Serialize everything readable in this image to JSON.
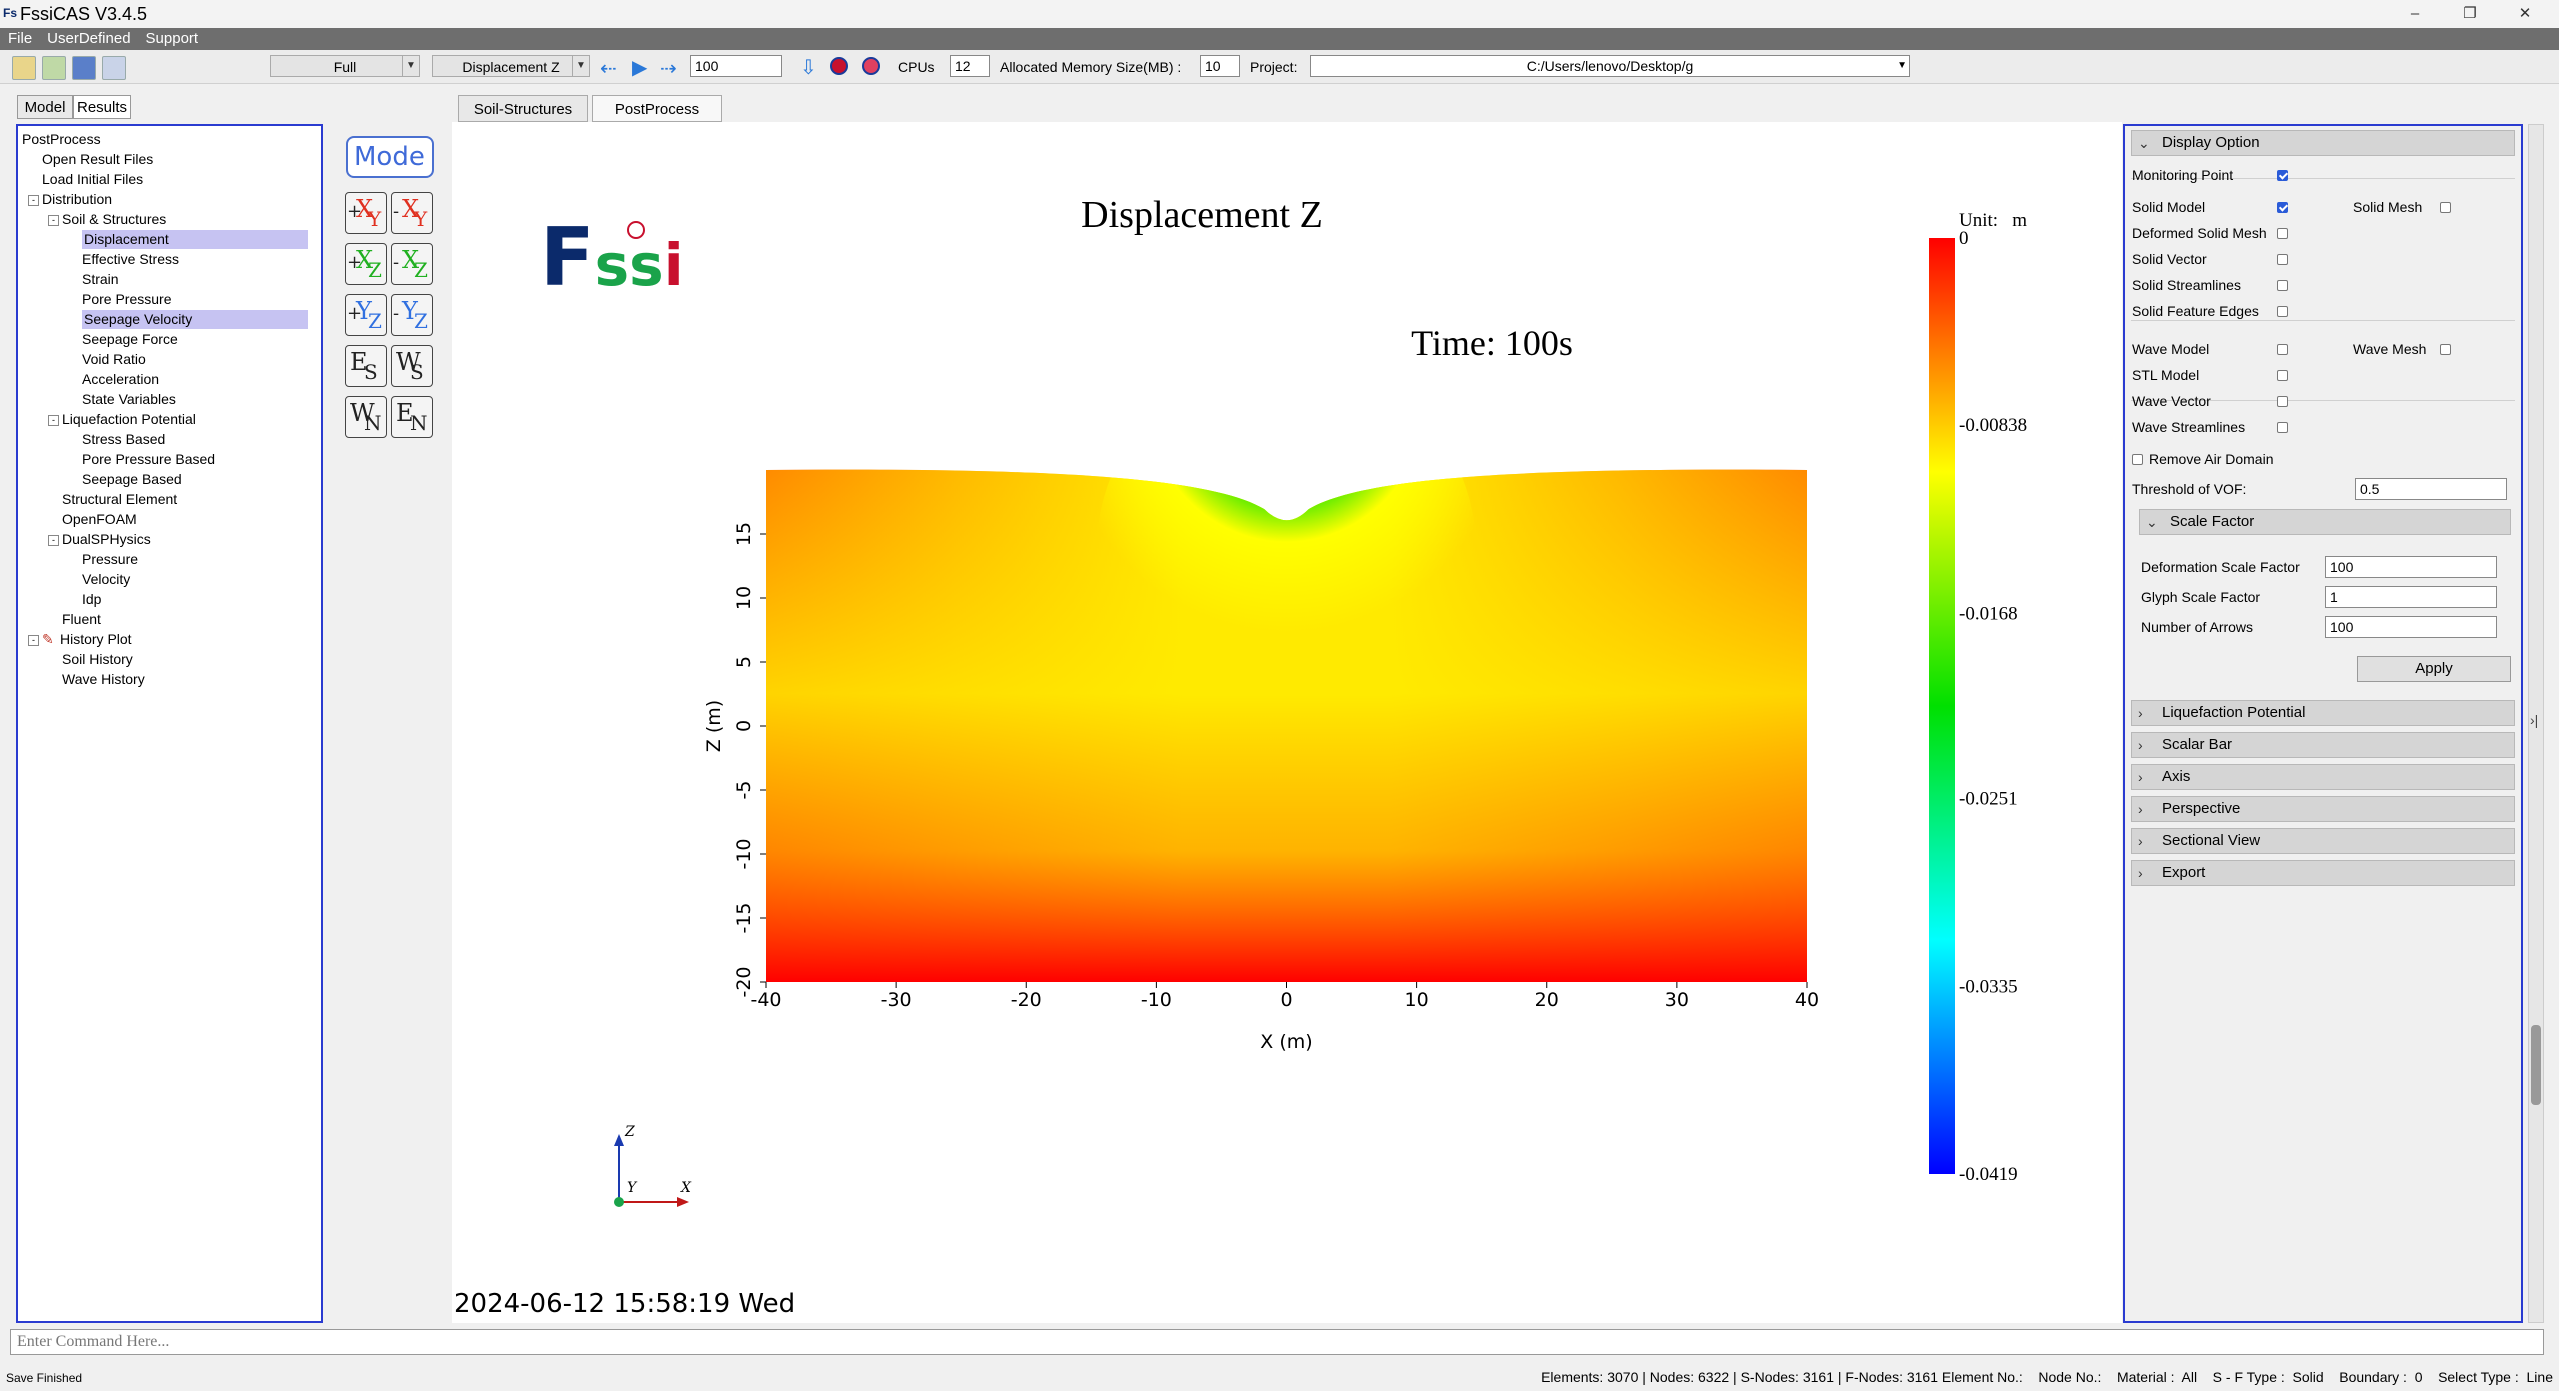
{
  "app": {
    "title": "FssiCAS V3.4.5",
    "logo_text": "Fs"
  },
  "menu": [
    "File",
    "UserDefined",
    "Support"
  ],
  "toolbar": {
    "view_mode": "Full",
    "result_type": "Displacement Z",
    "step_value": "100",
    "cpus_label": "CPUs",
    "cpus_value": "12",
    "memory_label": "Allocated Memory Size(MB) :",
    "memory_value": "10",
    "project_label": "Project:",
    "project_path": "C:/Users/lenovo/Desktop/g"
  },
  "left_tabs": [
    "Model",
    "Results"
  ],
  "tree": [
    {
      "label": "PostProcess",
      "level": 0
    },
    {
      "label": "Open Result Files",
      "level": 1
    },
    {
      "label": "Load Initial Files",
      "level": 1
    },
    {
      "label": "Distribution",
      "level": 1,
      "toggle": "-"
    },
    {
      "label": "Soil & Structures",
      "level": 2,
      "toggle": "-"
    },
    {
      "label": "Displacement",
      "level": 3,
      "selected": true
    },
    {
      "label": "Effective Stress",
      "level": 3
    },
    {
      "label": "Strain",
      "level": 3
    },
    {
      "label": "Pore Pressure",
      "level": 3
    },
    {
      "label": "Seepage Velocity",
      "level": 3,
      "selected": true
    },
    {
      "label": "Seepage Force",
      "level": 3
    },
    {
      "label": "Void Ratio",
      "level": 3
    },
    {
      "label": "Acceleration",
      "level": 3
    },
    {
      "label": "State Variables",
      "level": 3
    },
    {
      "label": "Liquefaction Potential",
      "level": 2,
      "toggle": "-"
    },
    {
      "label": "Stress Based",
      "level": 3
    },
    {
      "label": "Pore Pressure Based",
      "level": 3
    },
    {
      "label": "Seepage Based",
      "level": 3
    },
    {
      "label": "Structural Element",
      "level": 2
    },
    {
      "label": "OpenFOAM",
      "level": 2
    },
    {
      "label": "DualSPHysics",
      "level": 2,
      "toggle": "-"
    },
    {
      "label": "Pressure",
      "level": 3
    },
    {
      "label": "Velocity",
      "level": 3
    },
    {
      "label": "Idp",
      "level": 3
    },
    {
      "label": "Fluent",
      "level": 2
    },
    {
      "label": "History Plot",
      "level": 1,
      "toggle": "-",
      "icon": true
    },
    {
      "label": "Soil History",
      "level": 2
    },
    {
      "label": "Wave History",
      "level": 2
    }
  ],
  "view_buttons": {
    "mode_label": "Mode",
    "rows": [
      [
        {
          "sign": "+",
          "ax": "X",
          "sub": "Y"
        },
        {
          "sign": "-",
          "ax": "X",
          "sub": "Y"
        }
      ],
      [
        {
          "sign": "+",
          "ax": "X",
          "sub": "Z"
        },
        {
          "sign": "-",
          "ax": "X",
          "sub": "Z"
        }
      ],
      [
        {
          "sign": "+",
          "ax": "Y",
          "sub": "Z"
        },
        {
          "sign": "-",
          "ax": "Y",
          "sub": "Z"
        }
      ],
      [
        {
          "sign": "",
          "ax": "E",
          "sub": "S"
        },
        {
          "sign": "",
          "ax": "W",
          "sub": "S"
        }
      ],
      [
        {
          "sign": "",
          "ax": "W",
          "sub": "N"
        },
        {
          "sign": "",
          "ax": "E",
          "sub": "N"
        }
      ]
    ]
  },
  "center_tabs": [
    "Soil-Structures",
    "PostProcess"
  ],
  "plot": {
    "brand": "Fssi",
    "title": "Displacement Z",
    "time_label": "Time: 100s",
    "unit_label": "Unit:   m",
    "colorbar_ticks": [
      "0",
      "-0.00838",
      "-0.0168",
      "-0.0251",
      "-0.0335",
      "-0.0419"
    ],
    "colors": {
      "min": "#0000ff",
      "mid": "#00e000",
      "zero": "#ff0000"
    },
    "timestamp": "2024-06-12 15:58:19 Wed"
  },
  "chart_data": {
    "type": "heatmap",
    "title": "Displacement Z",
    "subtitle": "Time: 100s",
    "xlabel": "X (m)",
    "ylabel": "Z (m)",
    "xlim": [
      -40,
      40
    ],
    "ylim": [
      -20,
      20
    ],
    "x_ticks": [
      -40,
      -30,
      -20,
      -10,
      0,
      10,
      20,
      30,
      40
    ],
    "y_ticks": [
      -20,
      -15,
      -10,
      -5,
      0,
      5,
      10,
      15
    ],
    "colorbar": {
      "min": -0.0419,
      "max": 0,
      "ticks": [
        0,
        -0.00838,
        -0.0168,
        -0.0251,
        -0.0335,
        -0.0419
      ],
      "unit": "m"
    },
    "min_location": [
      0,
      16
    ]
  },
  "right_panel": {
    "header": "Display Option",
    "options": [
      {
        "label": "Monitoring Point",
        "checked": true
      },
      {
        "label": "Solid Model",
        "checked": true,
        "right_label": "Solid Mesh",
        "right_checked": false
      },
      {
        "label": "Deformed Solid Mesh",
        "checked": false
      },
      {
        "label": "Solid Vector",
        "checked": false
      },
      {
        "label": "Solid Streamlines",
        "checked": false
      },
      {
        "label": "Solid Feature Edges",
        "checked": false
      },
      {
        "label": "Wave Model",
        "checked": false,
        "right_label": "Wave Mesh",
        "right_checked": false
      },
      {
        "label": "STL Model",
        "checked": false
      },
      {
        "label": "Wave Vector",
        "checked": false
      },
      {
        "label": "Wave Streamlines",
        "checked": false
      }
    ],
    "remove_air": {
      "label": "Remove Air Domain",
      "checked": false
    },
    "vof": {
      "label": "Threshold of VOF:",
      "value": "0.5"
    },
    "scale_header": "Scale Factor",
    "scale": [
      {
        "label": "Deformation Scale Factor",
        "value": "100"
      },
      {
        "label": "Glyph Scale Factor",
        "value": "1"
      },
      {
        "label": "Number of Arrows",
        "value": "100"
      }
    ],
    "apply_label": "Apply",
    "sections": [
      "Liquefaction Potential",
      "Scalar Bar",
      "Axis",
      "Perspective",
      "Sectional View",
      "Export"
    ]
  },
  "command_placeholder": "Enter Command Here...",
  "status": {
    "left": "Save Finished",
    "right": "Elements: 3070 | Nodes: 6322 | S-Nodes: 3161 | F-Nodes: 3161 Element No.:    Node No.:    Material :  All    S - F Type :  Solid    Boundary :  0    Select Type :  Line"
  }
}
